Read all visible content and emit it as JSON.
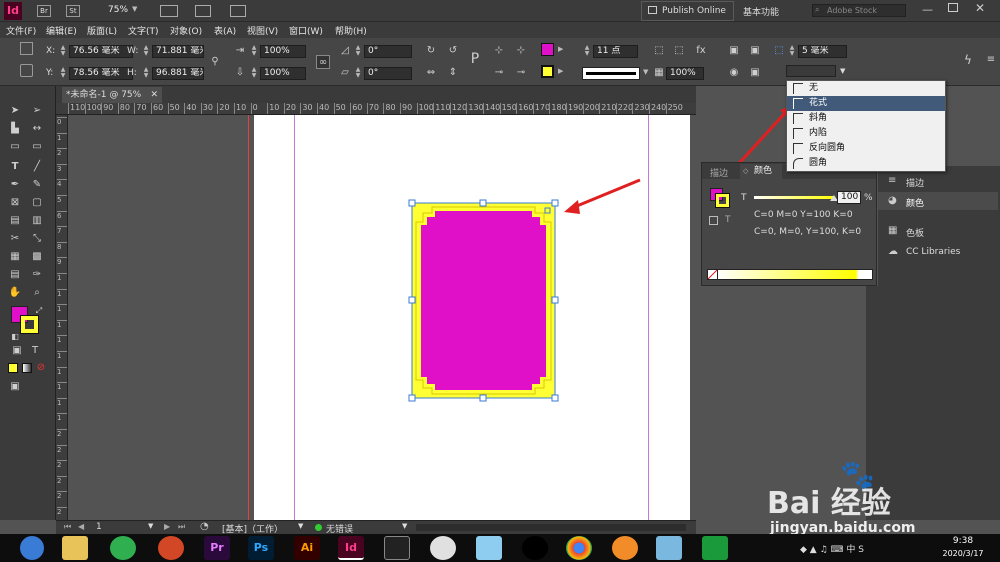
{
  "app": {
    "logo": "Id",
    "bridge": "Br",
    "stock": "St",
    "zoom": "75%",
    "publish_online": "Publish Online",
    "workspace": "基本功能",
    "search_placeholder": "Adobe Stock"
  },
  "menu": [
    "文件(F)",
    "编辑(E)",
    "版面(L)",
    "文字(T)",
    "对象(O)",
    "表(A)",
    "视图(V)",
    "窗口(W)",
    "帮助(H)"
  ],
  "control": {
    "x_label": "X:",
    "x_value": "76.56 毫米",
    "y_label": "Y:",
    "y_value": "78.56 毫米",
    "w_label": "W:",
    "w_value": "71.881 毫米",
    "h_label": "H:",
    "h_value": "96.881 毫米",
    "scale_x": "100%",
    "scale_y": "100%",
    "angle": "0°",
    "shear": "0°",
    "stroke_weight": "11 点",
    "opacity": "100%",
    "corner_size": "5 毫米"
  },
  "document_tab": "*未命名-1 @ 75%",
  "ruler_h": [
    "110",
    "100",
    "90",
    "80",
    "70",
    "60",
    "50",
    "40",
    "30",
    "20",
    "10",
    "0",
    "10",
    "20",
    "30",
    "40",
    "50",
    "60",
    "70",
    "80",
    "90",
    "100",
    "110",
    "120",
    "130",
    "140",
    "150",
    "160",
    "170",
    "180",
    "190",
    "200",
    "210",
    "220",
    "230",
    "240",
    "250"
  ],
  "ruler_v": [
    "0",
    "1",
    "2",
    "3",
    "4",
    "5",
    "6",
    "7",
    "8",
    "9",
    "1",
    "1",
    "1",
    "1",
    "1",
    "1",
    "1",
    "1",
    "1",
    "1",
    "2",
    "2",
    "2",
    "2",
    "2",
    "2"
  ],
  "corner_dropdown": {
    "items": [
      "无",
      "花式",
      "斜角",
      "内陷",
      "反向圆角",
      "圆角"
    ],
    "selected_index": 1
  },
  "color_panel": {
    "tab_stroke": "描边",
    "tab_color": "颜色",
    "tint_label": "T",
    "tint_value": "100",
    "percent": "%",
    "line1": "C=0 M=0 Y=100 K=0",
    "line2": "C=0, M=0, Y=100, K=0"
  },
  "right_panel": {
    "items": [
      "描边",
      "颜色",
      "色板",
      "CC Libraries"
    ]
  },
  "status": {
    "page": "1",
    "style": "[基本]（工作）",
    "errors": "无错误"
  },
  "taskbar": {
    "time": "9:38",
    "date": "2020/3/17",
    "apps": [
      "Pr",
      "Ps",
      "Ai",
      "Id"
    ]
  },
  "watermark": {
    "line1": "Bai 经验",
    "line2": "jingyan.baidu.com"
  },
  "colors": {
    "fill": "#e010c8",
    "stroke": "#ffff33",
    "accent_selection": "#415a79"
  }
}
